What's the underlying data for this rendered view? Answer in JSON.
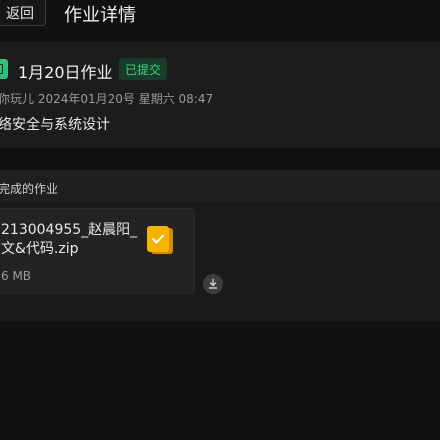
{
  "header": {
    "back_label": "返回",
    "title": "作业详情"
  },
  "assignment": {
    "icon": "document-icon",
    "title": "1月20日作业",
    "status_badge": "已提交",
    "meta": "你玩儿 2024年01月20号 星期六 08:47",
    "course": "络安全与系统设计"
  },
  "completed": {
    "section_label": "完成的作业",
    "files": [
      {
        "name": "213004955_赵晨阳_文&代码.zip",
        "size": "6 MB",
        "icon": "zip-file-icon"
      }
    ]
  },
  "colors": {
    "background": "#111111",
    "card": "#1c1c1c",
    "accent_green": "#3ecf7e",
    "zip_yellow": "#f5b400"
  }
}
